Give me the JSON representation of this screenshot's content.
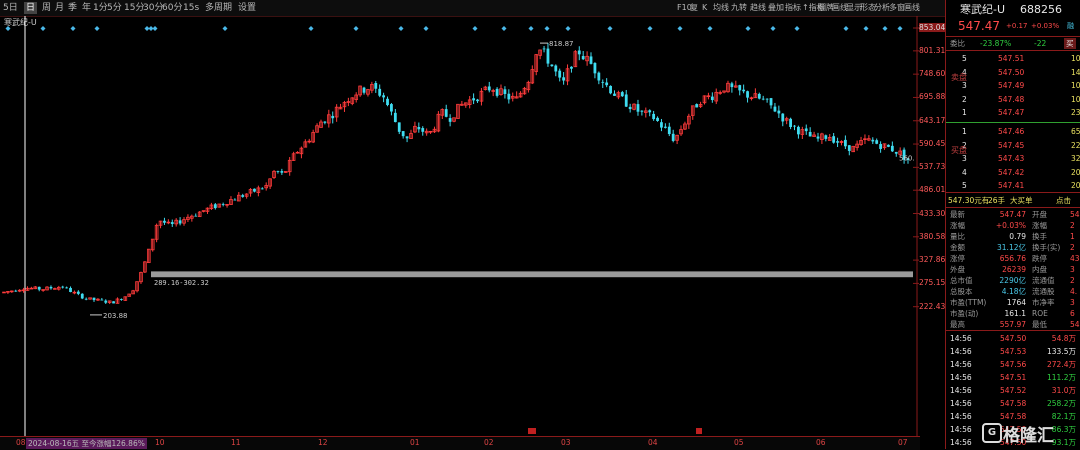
{
  "toolbar": {
    "left_items": [
      "5日",
      "日",
      "周",
      "月",
      "季",
      "年",
      "1分",
      "5分",
      "15分",
      "30分",
      "60分",
      "15s",
      "多周期",
      "设置"
    ],
    "active_index": 1,
    "right_items": [
      "F10",
      "复",
      "K",
      "均线",
      "九转",
      "趋线",
      "叠加",
      "指标",
      "↑指标",
      "翻牌",
      "画线",
      "显示",
      "形态",
      "分析",
      "多窗",
      "画线"
    ],
    "stock_label": "寒武纪-U"
  },
  "quote": {
    "name": "寒武纪-U",
    "code": "688256",
    "price": "547.47",
    "change": "+0.17",
    "change_pct": "+0.03%",
    "tag": "融",
    "webi_label": "委比",
    "webi": "-23.87%",
    "weicha": "-22",
    "buy_tag": "买",
    "sell_side_label": "卖盘",
    "buy_side_label": "买盘"
  },
  "asks": [
    {
      "level": "5",
      "price": "547.51",
      "vol": "10"
    },
    {
      "level": "4",
      "price": "547.50",
      "vol": "14"
    },
    {
      "level": "3",
      "price": "547.49",
      "vol": "10"
    },
    {
      "level": "2",
      "price": "547.48",
      "vol": "10"
    },
    {
      "level": "1",
      "price": "547.47",
      "vol": "23"
    }
  ],
  "bids": [
    {
      "level": "1",
      "price": "547.46",
      "vol": "65"
    },
    {
      "level": "2",
      "price": "547.45",
      "vol": "22"
    },
    {
      "level": "3",
      "price": "547.43",
      "vol": "32"
    },
    {
      "level": "4",
      "price": "547.42",
      "vol": "20"
    },
    {
      "level": "5",
      "price": "547.41",
      "vol": "20"
    }
  ],
  "big_order": {
    "price": "547.30元有",
    "qty": "26手",
    "type": "大买单",
    "action": "点击"
  },
  "stats": [
    {
      "l": "最新",
      "v": "547.47",
      "l2": "开盘",
      "v2": "54",
      "vc": "red"
    },
    {
      "l": "涨幅",
      "v": "+0.03%",
      "l2": "涨幅",
      "v2": "2",
      "vc": "red"
    },
    {
      "l": "量比",
      "v": "0.79",
      "l2": "换手",
      "v2": "1",
      "vc": "white"
    },
    {
      "l": "金额",
      "v": "31.12亿",
      "l2": "换手(实)",
      "v2": "2",
      "vc": "cyan"
    },
    {
      "l": "涨停",
      "v": "656.76",
      "l2": "跌停",
      "v2": "43",
      "vc": "red"
    },
    {
      "l": "外盘",
      "v": "26239",
      "l2": "内盘",
      "v2": "3",
      "vc": "red"
    },
    {
      "l": "总市值",
      "v": "2290亿",
      "l2": "流通值",
      "v2": "2",
      "vc": "cyan"
    },
    {
      "l": "总股本",
      "v": "4.18亿",
      "l2": "流通股",
      "v2": "4.",
      "vc": "cyan"
    },
    {
      "l": "市盈(TTM)",
      "v": "1764",
      "l2": "市净率",
      "v2": "3",
      "vc": "white"
    },
    {
      "l": "市盈(动)",
      "v": "161.1",
      "l2": "ROE",
      "v2": "6",
      "vc": "white"
    },
    {
      "l": "最高",
      "v": "557.97",
      "l2": "最低",
      "v2": "54",
      "vc": "red"
    }
  ],
  "ticks": [
    {
      "t": "14:56",
      "p": "547.50",
      "v": "54.8万",
      "vc": "red"
    },
    {
      "t": "14:56",
      "p": "547.53",
      "v": "133.5万",
      "vc": "white"
    },
    {
      "t": "14:56",
      "p": "547.56",
      "v": "272.4万",
      "vc": "red"
    },
    {
      "t": "14:56",
      "p": "547.51",
      "v": "111.2万",
      "vc": "green"
    },
    {
      "t": "14:56",
      "p": "547.52",
      "v": "31.0万",
      "vc": "red"
    },
    {
      "t": "14:56",
      "p": "547.58",
      "v": "258.2万",
      "vc": "green"
    },
    {
      "t": "14:56",
      "p": "547.58",
      "v": "82.1万",
      "vc": "green"
    },
    {
      "t": "14:56",
      "p": "547.50",
      "v": "86.3万",
      "vc": "green"
    },
    {
      "t": "14:56",
      "p": "547.50",
      "v": "93.1万",
      "vc": "green"
    }
  ],
  "logo_text": "格隆汇",
  "chart_data": {
    "type": "candlestick",
    "price_ticks": [
      "853.04",
      "801.31",
      "748.60",
      "695.88",
      "643.17",
      "590.45",
      "537.73",
      "486.01",
      "433.30",
      "380.58",
      "327.86",
      "275.15",
      "222.43"
    ],
    "ylim": [
      180,
      853.04
    ],
    "time_labels": [
      {
        "t": "08",
        "x": 16
      },
      {
        "t": "10",
        "x": 155
      },
      {
        "t": "11",
        "x": 231
      },
      {
        "t": "12",
        "x": 318
      },
      {
        "t": "01",
        "x": 410
      },
      {
        "t": "02",
        "x": 484
      },
      {
        "t": "03",
        "x": 561
      },
      {
        "t": "04",
        "x": 648
      },
      {
        "t": "05",
        "x": 734
      },
      {
        "t": "06",
        "x": 816
      },
      {
        "t": "07",
        "x": 898
      }
    ],
    "date_hint": "2024-08-16五 至今涨幅126.86%",
    "annotations": {
      "high_label": "818.87",
      "low_label": "203.88",
      "gap_label": "289.16-302.32",
      "last_label": "560."
    },
    "gap_zone": [
      289.16,
      302.32
    ],
    "num_candles": 232
  }
}
